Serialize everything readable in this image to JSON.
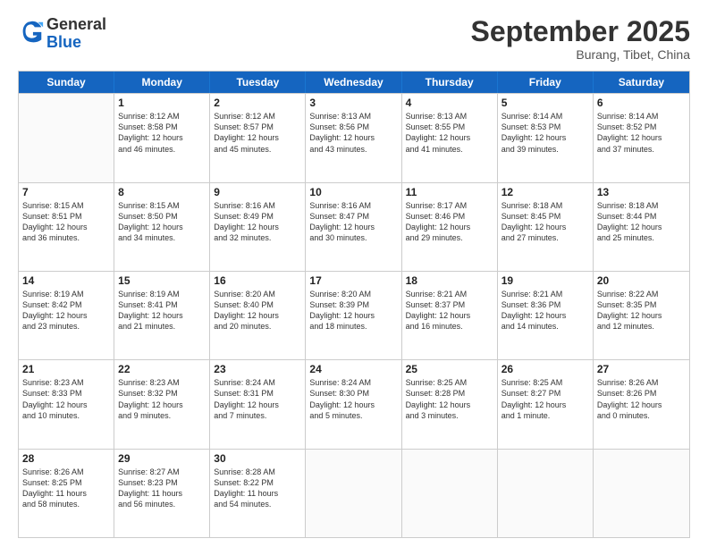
{
  "header": {
    "logo_general": "General",
    "logo_blue": "Blue",
    "month_title": "September 2025",
    "location": "Burang, Tibet, China"
  },
  "days_of_week": [
    "Sunday",
    "Monday",
    "Tuesday",
    "Wednesday",
    "Thursday",
    "Friday",
    "Saturday"
  ],
  "weeks": [
    [
      {
        "day": "",
        "lines": []
      },
      {
        "day": "1",
        "lines": [
          "Sunrise: 8:12 AM",
          "Sunset: 8:58 PM",
          "Daylight: 12 hours",
          "and 46 minutes."
        ]
      },
      {
        "day": "2",
        "lines": [
          "Sunrise: 8:12 AM",
          "Sunset: 8:57 PM",
          "Daylight: 12 hours",
          "and 45 minutes."
        ]
      },
      {
        "day": "3",
        "lines": [
          "Sunrise: 8:13 AM",
          "Sunset: 8:56 PM",
          "Daylight: 12 hours",
          "and 43 minutes."
        ]
      },
      {
        "day": "4",
        "lines": [
          "Sunrise: 8:13 AM",
          "Sunset: 8:55 PM",
          "Daylight: 12 hours",
          "and 41 minutes."
        ]
      },
      {
        "day": "5",
        "lines": [
          "Sunrise: 8:14 AM",
          "Sunset: 8:53 PM",
          "Daylight: 12 hours",
          "and 39 minutes."
        ]
      },
      {
        "day": "6",
        "lines": [
          "Sunrise: 8:14 AM",
          "Sunset: 8:52 PM",
          "Daylight: 12 hours",
          "and 37 minutes."
        ]
      }
    ],
    [
      {
        "day": "7",
        "lines": [
          "Sunrise: 8:15 AM",
          "Sunset: 8:51 PM",
          "Daylight: 12 hours",
          "and 36 minutes."
        ]
      },
      {
        "day": "8",
        "lines": [
          "Sunrise: 8:15 AM",
          "Sunset: 8:50 PM",
          "Daylight: 12 hours",
          "and 34 minutes."
        ]
      },
      {
        "day": "9",
        "lines": [
          "Sunrise: 8:16 AM",
          "Sunset: 8:49 PM",
          "Daylight: 12 hours",
          "and 32 minutes."
        ]
      },
      {
        "day": "10",
        "lines": [
          "Sunrise: 8:16 AM",
          "Sunset: 8:47 PM",
          "Daylight: 12 hours",
          "and 30 minutes."
        ]
      },
      {
        "day": "11",
        "lines": [
          "Sunrise: 8:17 AM",
          "Sunset: 8:46 PM",
          "Daylight: 12 hours",
          "and 29 minutes."
        ]
      },
      {
        "day": "12",
        "lines": [
          "Sunrise: 8:18 AM",
          "Sunset: 8:45 PM",
          "Daylight: 12 hours",
          "and 27 minutes."
        ]
      },
      {
        "day": "13",
        "lines": [
          "Sunrise: 8:18 AM",
          "Sunset: 8:44 PM",
          "Daylight: 12 hours",
          "and 25 minutes."
        ]
      }
    ],
    [
      {
        "day": "14",
        "lines": [
          "Sunrise: 8:19 AM",
          "Sunset: 8:42 PM",
          "Daylight: 12 hours",
          "and 23 minutes."
        ]
      },
      {
        "day": "15",
        "lines": [
          "Sunrise: 8:19 AM",
          "Sunset: 8:41 PM",
          "Daylight: 12 hours",
          "and 21 minutes."
        ]
      },
      {
        "day": "16",
        "lines": [
          "Sunrise: 8:20 AM",
          "Sunset: 8:40 PM",
          "Daylight: 12 hours",
          "and 20 minutes."
        ]
      },
      {
        "day": "17",
        "lines": [
          "Sunrise: 8:20 AM",
          "Sunset: 8:39 PM",
          "Daylight: 12 hours",
          "and 18 minutes."
        ]
      },
      {
        "day": "18",
        "lines": [
          "Sunrise: 8:21 AM",
          "Sunset: 8:37 PM",
          "Daylight: 12 hours",
          "and 16 minutes."
        ]
      },
      {
        "day": "19",
        "lines": [
          "Sunrise: 8:21 AM",
          "Sunset: 8:36 PM",
          "Daylight: 12 hours",
          "and 14 minutes."
        ]
      },
      {
        "day": "20",
        "lines": [
          "Sunrise: 8:22 AM",
          "Sunset: 8:35 PM",
          "Daylight: 12 hours",
          "and 12 minutes."
        ]
      }
    ],
    [
      {
        "day": "21",
        "lines": [
          "Sunrise: 8:23 AM",
          "Sunset: 8:33 PM",
          "Daylight: 12 hours",
          "and 10 minutes."
        ]
      },
      {
        "day": "22",
        "lines": [
          "Sunrise: 8:23 AM",
          "Sunset: 8:32 PM",
          "Daylight: 12 hours",
          "and 9 minutes."
        ]
      },
      {
        "day": "23",
        "lines": [
          "Sunrise: 8:24 AM",
          "Sunset: 8:31 PM",
          "Daylight: 12 hours",
          "and 7 minutes."
        ]
      },
      {
        "day": "24",
        "lines": [
          "Sunrise: 8:24 AM",
          "Sunset: 8:30 PM",
          "Daylight: 12 hours",
          "and 5 minutes."
        ]
      },
      {
        "day": "25",
        "lines": [
          "Sunrise: 8:25 AM",
          "Sunset: 8:28 PM",
          "Daylight: 12 hours",
          "and 3 minutes."
        ]
      },
      {
        "day": "26",
        "lines": [
          "Sunrise: 8:25 AM",
          "Sunset: 8:27 PM",
          "Daylight: 12 hours",
          "and 1 minute."
        ]
      },
      {
        "day": "27",
        "lines": [
          "Sunrise: 8:26 AM",
          "Sunset: 8:26 PM",
          "Daylight: 12 hours",
          "and 0 minutes."
        ]
      }
    ],
    [
      {
        "day": "28",
        "lines": [
          "Sunrise: 8:26 AM",
          "Sunset: 8:25 PM",
          "Daylight: 11 hours",
          "and 58 minutes."
        ]
      },
      {
        "day": "29",
        "lines": [
          "Sunrise: 8:27 AM",
          "Sunset: 8:23 PM",
          "Daylight: 11 hours",
          "and 56 minutes."
        ]
      },
      {
        "day": "30",
        "lines": [
          "Sunrise: 8:28 AM",
          "Sunset: 8:22 PM",
          "Daylight: 11 hours",
          "and 54 minutes."
        ]
      },
      {
        "day": "",
        "lines": []
      },
      {
        "day": "",
        "lines": []
      },
      {
        "day": "",
        "lines": []
      },
      {
        "day": "",
        "lines": []
      }
    ]
  ]
}
